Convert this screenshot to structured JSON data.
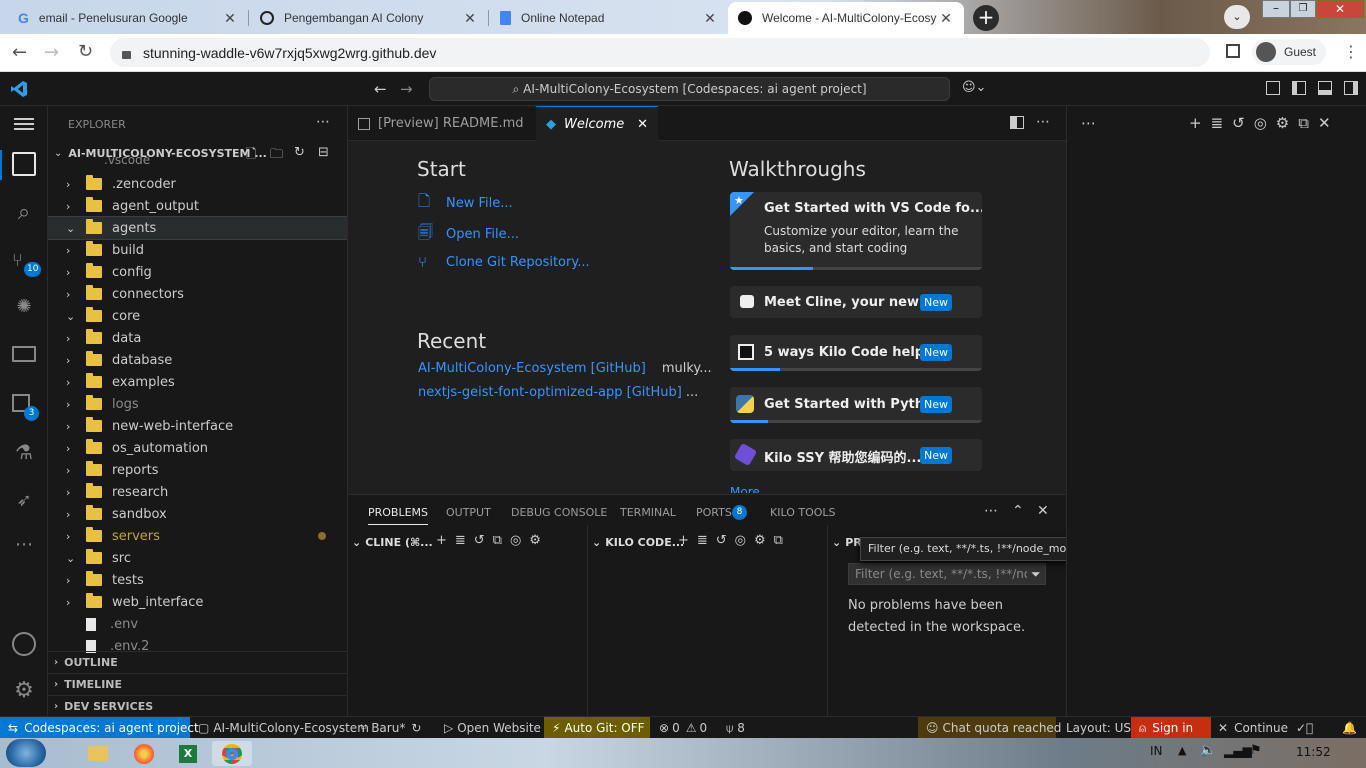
{
  "browser": {
    "tabs": [
      {
        "title": "email - Penelusuran Google",
        "icon": "google-icon"
      },
      {
        "title": "Pengembangan AI Colony",
        "icon": "chatgpt-icon"
      },
      {
        "title": "Online Notepad",
        "icon": "docs-icon"
      },
      {
        "title": "Welcome - AI-MultiColony-Ecosy",
        "icon": "github-icon",
        "active": true
      }
    ],
    "url": "stunning-waddle-v6w7rxjq5xwg2wrg.github.dev",
    "profile": "Guest"
  },
  "vscode": {
    "command_center": "AI-MultiColony-Ecosystem [Codespaces: ai agent project]",
    "activity": {
      "source_control_badge": "10",
      "remote_badge": "3"
    },
    "explorer": {
      "header": "EXPLORER",
      "root": "AI-MULTICOLONY-ECOSYSTEM ...",
      "partial_top": ".vscode",
      "items": [
        {
          "name": ".zencoder",
          "type": "folder",
          "open": false
        },
        {
          "name": "agent_output",
          "type": "folder",
          "open": false
        },
        {
          "name": "agents",
          "type": "folder",
          "open": true
        },
        {
          "name": "build",
          "type": "folder",
          "open": false
        },
        {
          "name": "config",
          "type": "folder",
          "open": false
        },
        {
          "name": "connectors",
          "type": "folder",
          "open": false
        },
        {
          "name": "core",
          "type": "folder",
          "open": true
        },
        {
          "name": "data",
          "type": "folder",
          "open": false
        },
        {
          "name": "database",
          "type": "folder",
          "open": false
        },
        {
          "name": "examples",
          "type": "folder",
          "open": false
        },
        {
          "name": "logs",
          "type": "folder",
          "open": false
        },
        {
          "name": "new-web-interface",
          "type": "folder",
          "open": false
        },
        {
          "name": "os_automation",
          "type": "folder",
          "open": false
        },
        {
          "name": "reports",
          "type": "folder",
          "open": false
        },
        {
          "name": "research",
          "type": "folder",
          "open": false
        },
        {
          "name": "sandbox",
          "type": "folder",
          "open": false
        },
        {
          "name": "servers",
          "type": "folder",
          "open": false
        },
        {
          "name": "src",
          "type": "folder",
          "open": true
        },
        {
          "name": "tests",
          "type": "folder",
          "open": false
        },
        {
          "name": "web_interface",
          "type": "folder",
          "open": false
        },
        {
          "name": ".env",
          "type": "file"
        },
        {
          "name": ".env.2",
          "type": "file"
        }
      ],
      "sections": [
        "OUTLINE",
        "TIMELINE",
        "DEV SERVICES"
      ]
    },
    "editor_tabs": [
      {
        "label": "[Preview] README.md"
      },
      {
        "label": "Welcome",
        "active": true
      }
    ],
    "welcome": {
      "start_title": "Start",
      "start_links": [
        "New File...",
        "Open File...",
        "Clone Git Repository..."
      ],
      "recent_title": "Recent",
      "recent": [
        {
          "name": "AI-MultiColony-Ecosystem [GitHub]",
          "path": "mulky..."
        },
        {
          "name": "nextjs-geist-font-optimized-app [GitHub]",
          "path": "..."
        }
      ],
      "walkthroughs_title": "Walkthroughs",
      "walkthroughs": [
        {
          "title": "Get Started with VS Code fo...",
          "desc": "Customize your editor, learn the basics, and start coding",
          "progress": 0.33
        },
        {
          "title": "Meet Cline, your new ...",
          "badge": "New",
          "progress": 0
        },
        {
          "title": "5 ways Kilo Code help...",
          "badge": "New",
          "progress": 0.2
        },
        {
          "title": "Get Started with Pyth...",
          "badge": "New",
          "progress": 0.15
        },
        {
          "title": "Kilo SSY 帮助您编码的...",
          "badge": "New",
          "progress": 0
        }
      ],
      "more": "More..."
    },
    "panel": {
      "tabs": [
        "PROBLEMS",
        "OUTPUT",
        "DEBUG CONSOLE",
        "TERMINAL",
        "PORTS",
        "KILO TOOLS"
      ],
      "ports_badge": "8",
      "views": [
        "CLINE (⌘...",
        "KILO CODE...",
        "PROBLEMS"
      ],
      "filter_placeholder": "Filter (e.g. text, **/*.ts, !**/nod...",
      "tooltip": "Filter (e.g. text, **/*.ts, !**/node_modules/**)",
      "no_problems": "No problems have been detected in the workspace."
    },
    "status": {
      "remote": "Codespaces: ai agent project",
      "repo": "AI-MultiColony-Ecosystem",
      "branch": "Baru*",
      "open_website": "Open Website",
      "auto_git": "Auto Git: OFF",
      "errors": "0",
      "warnings": "0",
      "ports": "8",
      "chat": "Chat quota reached",
      "layout": "Layout: US",
      "sign_in": "Sign in",
      "continue": "Continue"
    }
  },
  "taskbar": {
    "lang": "IN",
    "time": "11:52"
  }
}
